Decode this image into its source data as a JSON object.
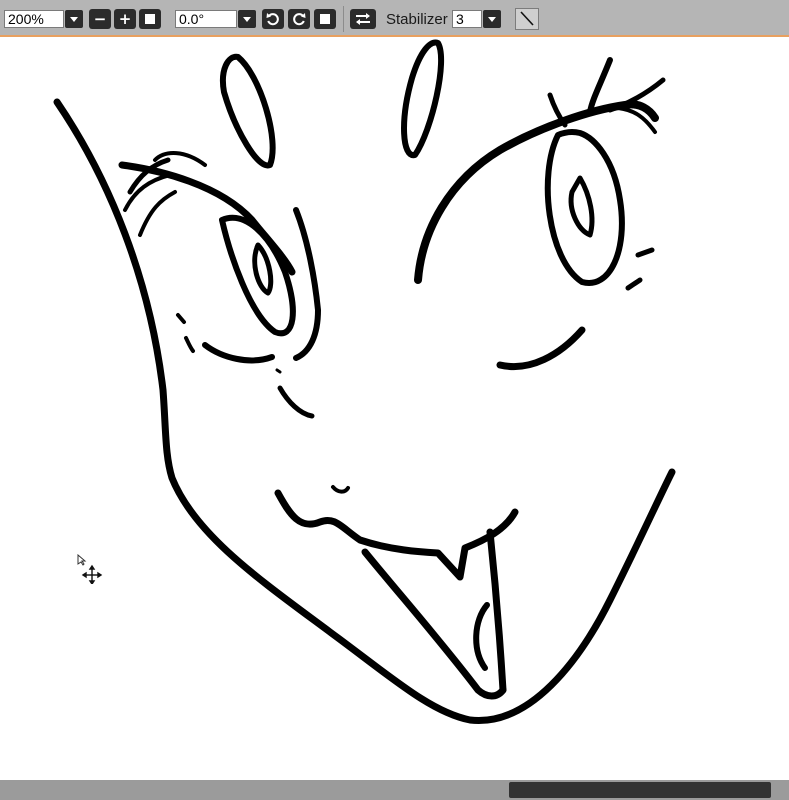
{
  "toolbar": {
    "zoom_value": "200%",
    "rotation_value": "0.0°",
    "stabilizer_label": "Stabilizer",
    "stabilizer_value": "3",
    "zoom_out_symbol": "−",
    "zoom_in_symbol": "+"
  },
  "icons": {
    "zoom_dropdown": "chevron-down-icon",
    "zoom_out": "minus-icon",
    "zoom_in": "plus-icon",
    "zoom_reset": "square-icon",
    "rotate_ccw": "rotate-left-icon",
    "rotate_cw": "rotate-right-icon",
    "rotate_reset": "square-icon",
    "flip": "flip-horizontal-icon",
    "line_tool": "diagonal-line-icon",
    "canvas_cursor": "move-cursor-icon"
  },
  "colors": {
    "toolbar_bg": "#b5b5b5",
    "toolbar_accent": "#e8a060",
    "button_bg": "#2b2b2b",
    "ink": "#000000",
    "scroll_track": "#9b9b9b",
    "scroll_thumb": "#333333"
  },
  "scrollbar": {
    "thumb_start_fraction": 0.645,
    "thumb_width_fraction": 0.332
  }
}
